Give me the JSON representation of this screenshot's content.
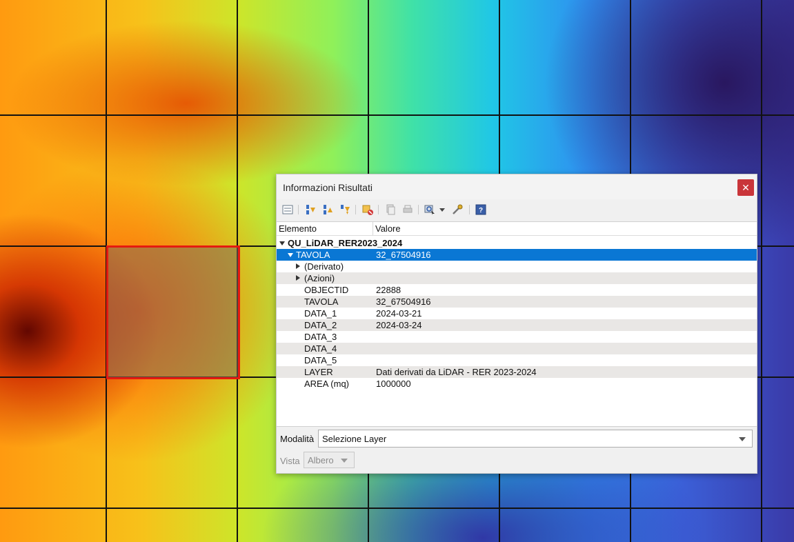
{
  "dialog": {
    "title": "Informazioni Risultati",
    "close_glyph": "✕"
  },
  "toolbar": {
    "icons": [
      "expand-tree-icon",
      "expand-all-icon",
      "collapse-all-icon",
      "expand-new-icon",
      "clear-results-icon",
      "copy-feature-icon",
      "print-icon",
      "identify-select-icon",
      "dropdown-icon",
      "settings-icon",
      "help-icon"
    ]
  },
  "tree": {
    "columns": {
      "element": "Elemento",
      "value": "Valore"
    },
    "layer_name": "QU_LiDAR_RER2023_2024",
    "feature": {
      "key": "TAVOLA",
      "value": "32_67504916"
    },
    "groups": [
      "(Derivato)",
      "(Azioni)"
    ],
    "attributes": [
      {
        "key": "OBJECTID",
        "value": "22888"
      },
      {
        "key": "TAVOLA",
        "value": "32_67504916"
      },
      {
        "key": "DATA_1",
        "value": "2024-03-21"
      },
      {
        "key": "DATA_2",
        "value": "2024-03-24"
      },
      {
        "key": "DATA_3",
        "value": ""
      },
      {
        "key": "DATA_4",
        "value": ""
      },
      {
        "key": "DATA_5",
        "value": ""
      },
      {
        "key": "LAYER",
        "value": "Dati derivati da LiDAR - RER 2023-2024"
      },
      {
        "key": "AREA (mq)",
        "value": "1000000"
      }
    ]
  },
  "mode": {
    "label": "Modalità",
    "value": "Selezione Layer"
  },
  "view": {
    "label": "Vista",
    "value": "Albero"
  },
  "colors": {
    "selection": "#0a77d4",
    "highlight_border": "#e51a10",
    "close_button": "#c9353a"
  }
}
